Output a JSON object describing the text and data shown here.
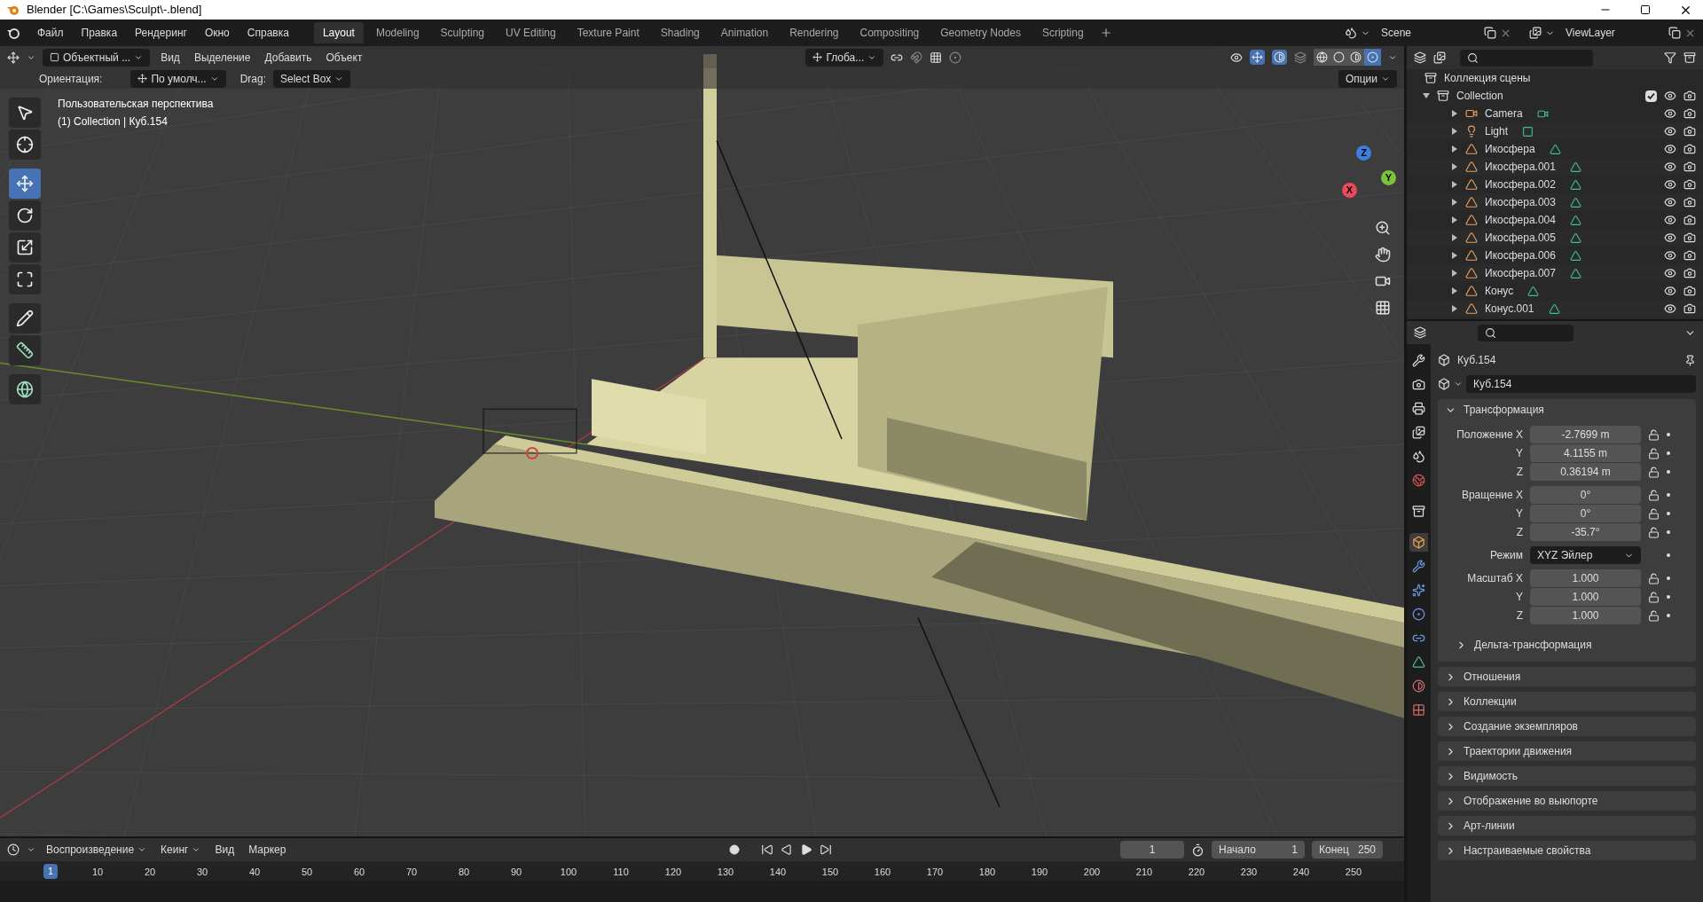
{
  "window": {
    "title": "Blender [C:\\Games\\Sculpt\\-.blend]"
  },
  "menu": [
    "Файл",
    "Правка",
    "Рендеринг",
    "Окно",
    "Справка"
  ],
  "workspaces": [
    {
      "label": "Layout",
      "selected": true
    },
    {
      "label": "Modeling",
      "selected": false
    },
    {
      "label": "Sculpting",
      "selected": false
    },
    {
      "label": "UV Editing",
      "selected": false
    },
    {
      "label": "Texture Paint",
      "selected": false
    },
    {
      "label": "Shading",
      "selected": false
    },
    {
      "label": "Animation",
      "selected": false
    },
    {
      "label": "Rendering",
      "selected": false
    },
    {
      "label": "Compositing",
      "selected": false
    },
    {
      "label": "Geometry Nodes",
      "selected": false
    },
    {
      "label": "Scripting",
      "selected": false
    }
  ],
  "scene": "Scene",
  "view_layer": "ViewLayer",
  "viewport": {
    "mode": "Объектный ...",
    "menus": [
      "Вид",
      "Выделение",
      "Добавить",
      "Объект"
    ],
    "transform_orientation": "Глоба...",
    "orientation_label": "Ориентация:",
    "orientation": "По умолч...",
    "drag_label": "Drag:",
    "drag": "Select Box",
    "options": "Опции",
    "overlay_lines": [
      "Пользовательская перспектива",
      "(1) Collection | Куб.154"
    ],
    "tools": [
      {
        "kind": "select",
        "selected": false
      },
      {
        "kind": "cursor",
        "selected": false
      },
      {
        "kind": "move",
        "selected": true
      },
      {
        "kind": "rotate",
        "selected": false
      },
      {
        "kind": "scale",
        "selected": false
      },
      {
        "kind": "transform",
        "selected": false
      },
      {
        "kind": "annotate",
        "selected": false
      },
      {
        "kind": "measure",
        "selected": false
      },
      {
        "kind": "add",
        "selected": false
      }
    ],
    "gizmo": [
      "Z",
      "Y",
      "X"
    ],
    "shading": [
      {
        "kind": "wireframe",
        "selected": false
      },
      {
        "kind": "solid",
        "selected": false
      },
      {
        "kind": "material",
        "selected": false
      },
      {
        "kind": "rendered",
        "selected": true
      }
    ]
  },
  "outliner": {
    "root": "Коллекция сцены",
    "collection": {
      "name": "Collection",
      "expanded": true,
      "checked": true,
      "children": [
        {
          "name": "Camera",
          "kind": "camera",
          "expanded": false
        },
        {
          "name": "Light",
          "kind": "light",
          "expanded": false
        },
        {
          "name": "Икосфера",
          "kind": "mesh",
          "expanded": false
        },
        {
          "name": "Икосфера.001",
          "kind": "mesh",
          "expanded": false
        },
        {
          "name": "Икосфера.002",
          "kind": "mesh",
          "expanded": false
        },
        {
          "name": "Икосфера.003",
          "kind": "mesh",
          "expanded": false
        },
        {
          "name": "Икосфера.004",
          "kind": "mesh",
          "expanded": false
        },
        {
          "name": "Икосфера.005",
          "kind": "mesh",
          "expanded": false
        },
        {
          "name": "Икосфера.006",
          "kind": "mesh",
          "expanded": false
        },
        {
          "name": "Икосфера.007",
          "kind": "mesh",
          "expanded": false
        },
        {
          "name": "Конус",
          "kind": "mesh",
          "expanded": false
        },
        {
          "name": "Конус.001",
          "kind": "mesh",
          "expanded": false
        }
      ]
    }
  },
  "properties": {
    "object_name": "Куб.154",
    "data_name": "Куб.154",
    "tabs": [
      {
        "kind": "tool",
        "selected": false
      },
      {
        "kind": "render",
        "selected": false
      },
      {
        "kind": "output",
        "selected": false
      },
      {
        "kind": "view_layer",
        "selected": false
      },
      {
        "kind": "scene",
        "selected": false
      },
      {
        "kind": "world",
        "selected": false
      },
      {
        "kind": "collection",
        "selected": false
      },
      {
        "kind": "object",
        "selected": true
      },
      {
        "kind": "modifiers",
        "selected": false
      },
      {
        "kind": "particles",
        "selected": false
      },
      {
        "kind": "physics",
        "selected": false
      },
      {
        "kind": "constraints",
        "selected": false
      },
      {
        "kind": "data",
        "selected": false
      },
      {
        "kind": "material",
        "selected": false
      },
      {
        "kind": "texture",
        "selected": false
      }
    ],
    "transform": {
      "title": "Трансформация",
      "expanded": true,
      "groups": [
        {
          "rows": [
            {
              "label": "Положение X",
              "value": "-2.7699 m",
              "kind": "number"
            },
            {
              "label": "Y",
              "value": "4.1155 m",
              "kind": "number"
            },
            {
              "label": "Z",
              "value": "0.36194 m",
              "kind": "number"
            }
          ]
        },
        {
          "rows": [
            {
              "label": "Вращение X",
              "value": "0°",
              "kind": "number"
            },
            {
              "label": "Y",
              "value": "0°",
              "kind": "number"
            },
            {
              "label": "Z",
              "value": "-35.7°",
              "kind": "number"
            }
          ]
        },
        {
          "rows": [
            {
              "label": "Режим",
              "value": "XYZ Эйлер",
              "kind": "dropdown"
            }
          ]
        },
        {
          "rows": [
            {
              "label": "Масштаб X",
              "value": "1.000",
              "kind": "number"
            },
            {
              "label": "Y",
              "value": "1.000",
              "kind": "number"
            },
            {
              "label": "Z",
              "value": "1.000",
              "kind": "number"
            }
          ]
        }
      ],
      "subpanel": {
        "title": "Дельта-трансформация",
        "expanded": false
      }
    },
    "panels": [
      {
        "title": "Отношения",
        "expanded": false
      },
      {
        "title": "Коллекции",
        "expanded": false
      },
      {
        "title": "Создание экземпляров",
        "expanded": false
      },
      {
        "title": "Траектории движения",
        "expanded": false
      },
      {
        "title": "Видимость",
        "expanded": false
      },
      {
        "title": "Отображение во выюпорте",
        "expanded": false
      },
      {
        "title": "Арт-линии",
        "expanded": false
      },
      {
        "title": "Настраиваемые свойства",
        "expanded": false
      }
    ]
  },
  "timeline": {
    "menus": [
      {
        "label": "Воспроизведение",
        "kind": "dropdown"
      },
      {
        "label": "Кеинг",
        "kind": "dropdown"
      },
      {
        "label": "Вид",
        "kind": "menu"
      },
      {
        "label": "Маркер",
        "kind": "menu"
      }
    ],
    "current_frame": "1",
    "start_label": "Начало",
    "start": "1",
    "end_label": "Конец",
    "end": "250",
    "playhead": "1",
    "ruler": [
      "10",
      "20",
      "30",
      "40",
      "50",
      "60",
      "70",
      "80",
      "90",
      "100",
      "110",
      "120",
      "130",
      "140",
      "150",
      "160",
      "170",
      "180",
      "190",
      "200",
      "210",
      "220",
      "230",
      "240",
      "250"
    ]
  }
}
